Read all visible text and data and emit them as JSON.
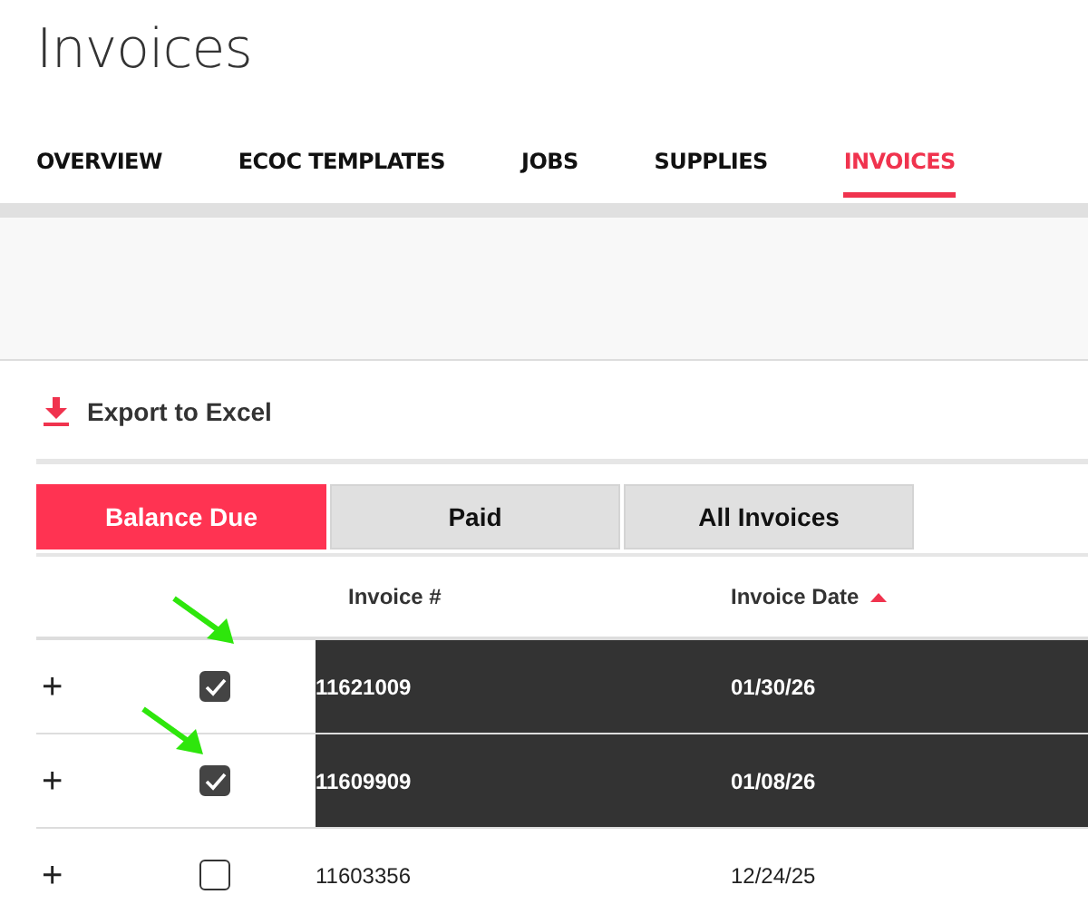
{
  "page": {
    "title": "Invoices"
  },
  "nav_tabs": [
    {
      "label": "OVERVIEW",
      "selected": false
    },
    {
      "label": "ECOC TEMPLATES",
      "selected": false
    },
    {
      "label": "JOBS",
      "selected": false
    },
    {
      "label": "SUPPLIES",
      "selected": false
    },
    {
      "label": "INVOICES",
      "selected": true
    }
  ],
  "export_link": {
    "label": "Export to Excel"
  },
  "filter_tabs": [
    {
      "label": "Balance Due",
      "selected": true
    },
    {
      "label": "Paid",
      "selected": false
    },
    {
      "label": "All Invoices",
      "selected": false
    }
  ],
  "table": {
    "columns": [
      {
        "label": "Invoice #",
        "sorted": false
      },
      {
        "label": "Invoice Date",
        "sorted": true
      }
    ],
    "rows": [
      {
        "expand": "+",
        "checked": true,
        "invoice": "11621009",
        "date": "01/30/26",
        "annotated": true
      },
      {
        "expand": "+",
        "checked": true,
        "invoice": "11609909",
        "date": "01/08/26",
        "annotated": true
      },
      {
        "expand": "+",
        "checked": false,
        "invoice": "11603356",
        "date": "12/24/25",
        "annotated": false
      }
    ]
  }
}
